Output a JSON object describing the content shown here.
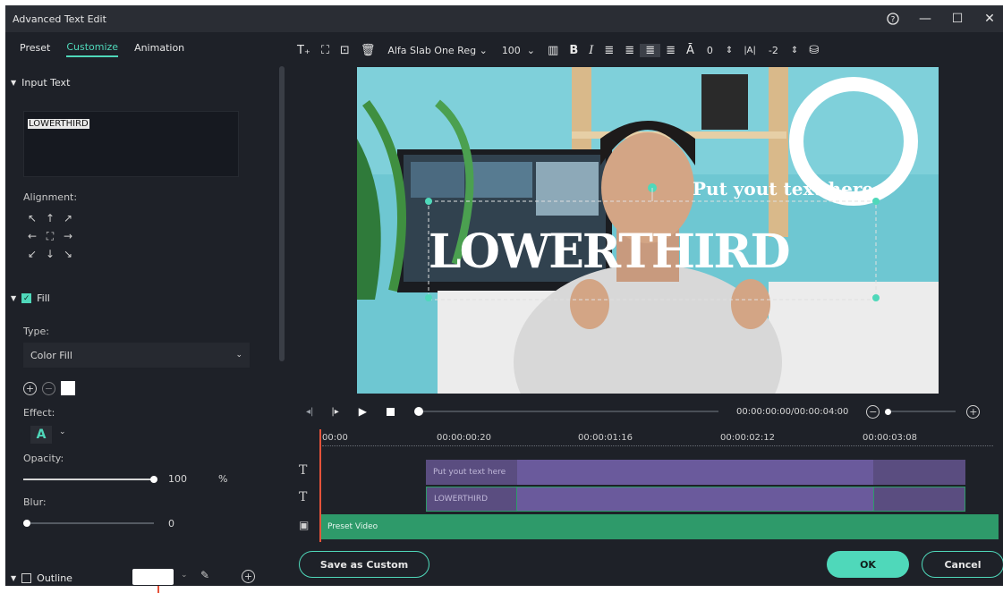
{
  "window": {
    "title": "Advanced Text Edit",
    "controls": {
      "help": "?",
      "minimize": "—",
      "maximize": "☐",
      "close": "✕"
    }
  },
  "tabs": [
    {
      "label": "Preset"
    },
    {
      "label": "Customize",
      "active": true
    },
    {
      "label": "Animation"
    }
  ],
  "left_panel": {
    "input_text": {
      "header": "Input Text",
      "value": "LOWERTHIRD"
    },
    "alignment": {
      "label": "Alignment:"
    },
    "fill": {
      "header": "Fill",
      "checked": true,
      "type_label": "Type:",
      "type_value": "Color Fill",
      "color": "#ffffff",
      "effect_label": "Effect:",
      "opacity_label": "Opacity:",
      "opacity_value": "100",
      "opacity_unit": "%",
      "blur_label": "Blur:",
      "blur_value": "0"
    },
    "outline": {
      "header": "Outline",
      "checked": false,
      "color": "#ffffff"
    }
  },
  "toolbar": {
    "font": "Alfa Slab One Reg",
    "size": "100",
    "bold": "B",
    "italic": "I",
    "line_spacing": "0",
    "char_spacing": "-2"
  },
  "preview": {
    "main_text": "LOWERTHIRD",
    "sub_text": "Put yout text here"
  },
  "transport": {
    "timecode": "00:00:00:00/00:00:04:00"
  },
  "timeline": {
    "ticks": [
      "00:00",
      "00:00:00:20",
      "00:00:01:16",
      "00:00:02:12",
      "00:00:03:08"
    ],
    "tracks": [
      {
        "name": "Put yout text here",
        "type": "text"
      },
      {
        "name": "LOWERTHIRD",
        "type": "text"
      },
      {
        "name": "Preset Video",
        "type": "video"
      }
    ]
  },
  "footer": {
    "save_custom": "Save as Custom",
    "ok": "OK",
    "cancel": "Cancel"
  },
  "colors": {
    "accent": "#4fd8ba",
    "clip_purple": "#6a5a9c",
    "clip_green": "#2e9a6a",
    "bg": "#1e2128"
  }
}
